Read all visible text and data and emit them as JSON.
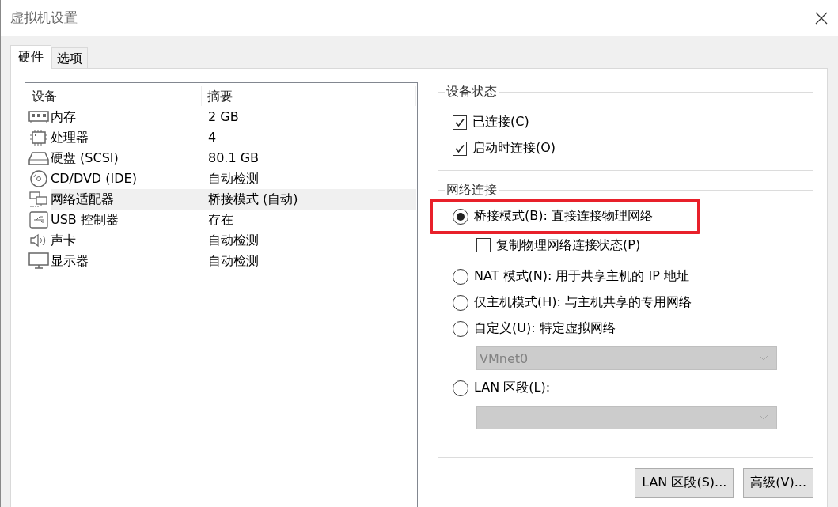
{
  "window": {
    "title": "虚拟机设置"
  },
  "tabs": [
    {
      "label": "硬件",
      "selected": true
    },
    {
      "label": "选项",
      "selected": false
    }
  ],
  "device_table": {
    "columns": [
      "设备",
      "摘要"
    ],
    "rows": [
      {
        "kind": "memory",
        "device": "内存",
        "summary": "2 GB",
        "selected": false
      },
      {
        "kind": "cpu",
        "device": "处理器",
        "summary": "4",
        "selected": false
      },
      {
        "kind": "disk",
        "device": "硬盘 (SCSI)",
        "summary": "80.1 GB",
        "selected": false
      },
      {
        "kind": "cd",
        "device": "CD/DVD (IDE)",
        "summary": "自动检测",
        "selected": false
      },
      {
        "kind": "network",
        "device": "网络适配器",
        "summary": "桥接模式 (自动)",
        "selected": true
      },
      {
        "kind": "usb",
        "device": "USB 控制器",
        "summary": "存在",
        "selected": false
      },
      {
        "kind": "sound",
        "device": "声卡",
        "summary": "自动检测",
        "selected": false
      },
      {
        "kind": "display",
        "device": "显示器",
        "summary": "自动检测",
        "selected": false
      }
    ]
  },
  "device_status": {
    "title": "设备状态",
    "items": [
      {
        "label": "已连接(C)",
        "checked": true
      },
      {
        "label": "启动时连接(O)",
        "checked": true
      }
    ]
  },
  "network_connection": {
    "title": "网络连接",
    "items": [
      {
        "kind": "radio",
        "label": "桥接模式(B): 直接连接物理网络",
        "selected": true,
        "highlighted": true
      },
      {
        "kind": "checkbox",
        "label": "复制物理网络连接状态(P)",
        "checked": false
      },
      {
        "kind": "radio",
        "label": "NAT 模式(N): 用于共享主机的 IP 地址",
        "selected": false
      },
      {
        "kind": "radio",
        "label": "仅主机模式(H): 与主机共享的专用网络",
        "selected": false
      },
      {
        "kind": "radio",
        "label": "自定义(U): 特定虚拟网络",
        "selected": false
      },
      {
        "kind": "dropdown",
        "value": "VMnet0",
        "disabled": true
      },
      {
        "kind": "radio",
        "label": "LAN 区段(L):",
        "selected": false
      },
      {
        "kind": "dropdown",
        "disabled": true
      }
    ]
  },
  "buttons": [
    "LAN 区段(S)...",
    "高级(V)..."
  ]
}
